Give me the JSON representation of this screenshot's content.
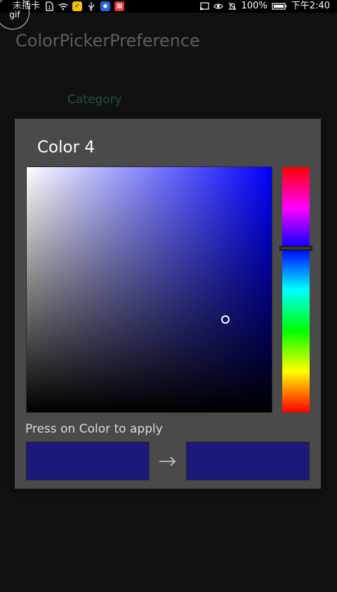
{
  "status_bar": {
    "carrier": "未插卡",
    "battery": "100%",
    "time": "下午2:40",
    "icons": [
      "sim-card-icon",
      "wifi-icon",
      "app-yellow-icon",
      "usb-icon",
      "shield-icon",
      "app-red-icon",
      "cast-icon",
      "eye-icon",
      "mute-icon",
      "battery-icon"
    ]
  },
  "overlay": {
    "gif_label": "gif"
  },
  "app": {
    "title": "ColorPickerPreference",
    "category": "Category"
  },
  "dialog": {
    "title": "Color 4",
    "hint": "Press on Color to apply",
    "hue_color": "#0000ff",
    "selected_color": "#1a1a7a",
    "old_color": "#1a1a7a",
    "new_color": "#1a1a7a",
    "saturation": 0.79,
    "value": 0.38,
    "hue_fraction": 0.33,
    "arrow_icon": "arrow-right-icon"
  },
  "colors": {
    "background": "#111111",
    "dialog_bg": "#4a4a4a",
    "title_dim": "#5e5e5e",
    "category_teal": "#1f4f4a"
  }
}
